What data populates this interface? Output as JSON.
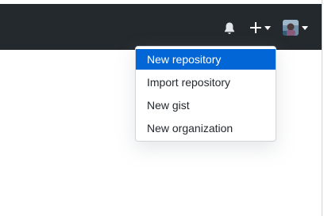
{
  "header": {
    "background": "#24292e",
    "icons": [
      "bell-icon",
      "plus-icon",
      "caret-down-icon",
      "avatar",
      "caret-down-icon"
    ]
  },
  "dropdown": {
    "items": [
      {
        "label": "New repository",
        "active": true
      },
      {
        "label": "Import repository",
        "active": false
      },
      {
        "label": "New gist",
        "active": false
      },
      {
        "label": "New organization",
        "active": false
      }
    ],
    "active_color": "#0366d6"
  }
}
